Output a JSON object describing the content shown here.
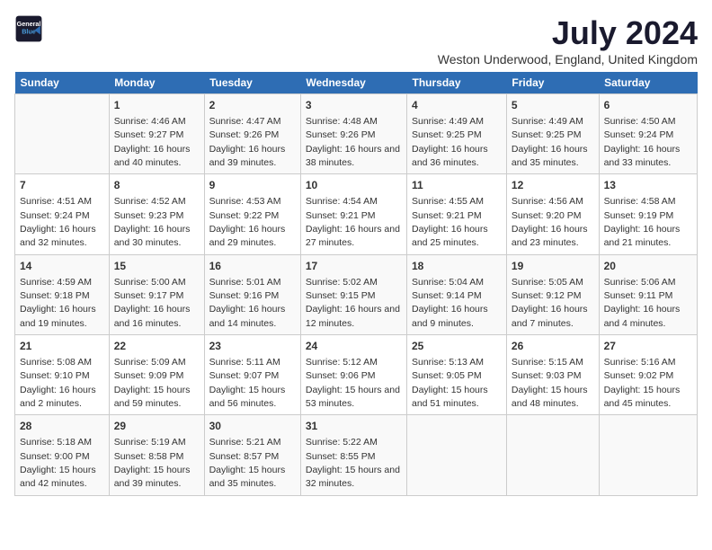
{
  "logo": {
    "line1": "General",
    "line2": "Blue"
  },
  "title": "July 2024",
  "subtitle": "Weston Underwood, England, United Kingdom",
  "headers": [
    "Sunday",
    "Monday",
    "Tuesday",
    "Wednesday",
    "Thursday",
    "Friday",
    "Saturday"
  ],
  "weeks": [
    [
      {
        "day": "",
        "sunrise": "",
        "sunset": "",
        "daylight": ""
      },
      {
        "day": "1",
        "sunrise": "Sunrise: 4:46 AM",
        "sunset": "Sunset: 9:27 PM",
        "daylight": "Daylight: 16 hours and 40 minutes."
      },
      {
        "day": "2",
        "sunrise": "Sunrise: 4:47 AM",
        "sunset": "Sunset: 9:26 PM",
        "daylight": "Daylight: 16 hours and 39 minutes."
      },
      {
        "day": "3",
        "sunrise": "Sunrise: 4:48 AM",
        "sunset": "Sunset: 9:26 PM",
        "daylight": "Daylight: 16 hours and 38 minutes."
      },
      {
        "day": "4",
        "sunrise": "Sunrise: 4:49 AM",
        "sunset": "Sunset: 9:25 PM",
        "daylight": "Daylight: 16 hours and 36 minutes."
      },
      {
        "day": "5",
        "sunrise": "Sunrise: 4:49 AM",
        "sunset": "Sunset: 9:25 PM",
        "daylight": "Daylight: 16 hours and 35 minutes."
      },
      {
        "day": "6",
        "sunrise": "Sunrise: 4:50 AM",
        "sunset": "Sunset: 9:24 PM",
        "daylight": "Daylight: 16 hours and 33 minutes."
      }
    ],
    [
      {
        "day": "7",
        "sunrise": "Sunrise: 4:51 AM",
        "sunset": "Sunset: 9:24 PM",
        "daylight": "Daylight: 16 hours and 32 minutes."
      },
      {
        "day": "8",
        "sunrise": "Sunrise: 4:52 AM",
        "sunset": "Sunset: 9:23 PM",
        "daylight": "Daylight: 16 hours and 30 minutes."
      },
      {
        "day": "9",
        "sunrise": "Sunrise: 4:53 AM",
        "sunset": "Sunset: 9:22 PM",
        "daylight": "Daylight: 16 hours and 29 minutes."
      },
      {
        "day": "10",
        "sunrise": "Sunrise: 4:54 AM",
        "sunset": "Sunset: 9:21 PM",
        "daylight": "Daylight: 16 hours and 27 minutes."
      },
      {
        "day": "11",
        "sunrise": "Sunrise: 4:55 AM",
        "sunset": "Sunset: 9:21 PM",
        "daylight": "Daylight: 16 hours and 25 minutes."
      },
      {
        "day": "12",
        "sunrise": "Sunrise: 4:56 AM",
        "sunset": "Sunset: 9:20 PM",
        "daylight": "Daylight: 16 hours and 23 minutes."
      },
      {
        "day": "13",
        "sunrise": "Sunrise: 4:58 AM",
        "sunset": "Sunset: 9:19 PM",
        "daylight": "Daylight: 16 hours and 21 minutes."
      }
    ],
    [
      {
        "day": "14",
        "sunrise": "Sunrise: 4:59 AM",
        "sunset": "Sunset: 9:18 PM",
        "daylight": "Daylight: 16 hours and 19 minutes."
      },
      {
        "day": "15",
        "sunrise": "Sunrise: 5:00 AM",
        "sunset": "Sunset: 9:17 PM",
        "daylight": "Daylight: 16 hours and 16 minutes."
      },
      {
        "day": "16",
        "sunrise": "Sunrise: 5:01 AM",
        "sunset": "Sunset: 9:16 PM",
        "daylight": "Daylight: 16 hours and 14 minutes."
      },
      {
        "day": "17",
        "sunrise": "Sunrise: 5:02 AM",
        "sunset": "Sunset: 9:15 PM",
        "daylight": "Daylight: 16 hours and 12 minutes."
      },
      {
        "day": "18",
        "sunrise": "Sunrise: 5:04 AM",
        "sunset": "Sunset: 9:14 PM",
        "daylight": "Daylight: 16 hours and 9 minutes."
      },
      {
        "day": "19",
        "sunrise": "Sunrise: 5:05 AM",
        "sunset": "Sunset: 9:12 PM",
        "daylight": "Daylight: 16 hours and 7 minutes."
      },
      {
        "day": "20",
        "sunrise": "Sunrise: 5:06 AM",
        "sunset": "Sunset: 9:11 PM",
        "daylight": "Daylight: 16 hours and 4 minutes."
      }
    ],
    [
      {
        "day": "21",
        "sunrise": "Sunrise: 5:08 AM",
        "sunset": "Sunset: 9:10 PM",
        "daylight": "Daylight: 16 hours and 2 minutes."
      },
      {
        "day": "22",
        "sunrise": "Sunrise: 5:09 AM",
        "sunset": "Sunset: 9:09 PM",
        "daylight": "Daylight: 15 hours and 59 minutes."
      },
      {
        "day": "23",
        "sunrise": "Sunrise: 5:11 AM",
        "sunset": "Sunset: 9:07 PM",
        "daylight": "Daylight: 15 hours and 56 minutes."
      },
      {
        "day": "24",
        "sunrise": "Sunrise: 5:12 AM",
        "sunset": "Sunset: 9:06 PM",
        "daylight": "Daylight: 15 hours and 53 minutes."
      },
      {
        "day": "25",
        "sunrise": "Sunrise: 5:13 AM",
        "sunset": "Sunset: 9:05 PM",
        "daylight": "Daylight: 15 hours and 51 minutes."
      },
      {
        "day": "26",
        "sunrise": "Sunrise: 5:15 AM",
        "sunset": "Sunset: 9:03 PM",
        "daylight": "Daylight: 15 hours and 48 minutes."
      },
      {
        "day": "27",
        "sunrise": "Sunrise: 5:16 AM",
        "sunset": "Sunset: 9:02 PM",
        "daylight": "Daylight: 15 hours and 45 minutes."
      }
    ],
    [
      {
        "day": "28",
        "sunrise": "Sunrise: 5:18 AM",
        "sunset": "Sunset: 9:00 PM",
        "daylight": "Daylight: 15 hours and 42 minutes."
      },
      {
        "day": "29",
        "sunrise": "Sunrise: 5:19 AM",
        "sunset": "Sunset: 8:58 PM",
        "daylight": "Daylight: 15 hours and 39 minutes."
      },
      {
        "day": "30",
        "sunrise": "Sunrise: 5:21 AM",
        "sunset": "Sunset: 8:57 PM",
        "daylight": "Daylight: 15 hours and 35 minutes."
      },
      {
        "day": "31",
        "sunrise": "Sunrise: 5:22 AM",
        "sunset": "Sunset: 8:55 PM",
        "daylight": "Daylight: 15 hours and 32 minutes."
      },
      {
        "day": "",
        "sunrise": "",
        "sunset": "",
        "daylight": ""
      },
      {
        "day": "",
        "sunrise": "",
        "sunset": "",
        "daylight": ""
      },
      {
        "day": "",
        "sunrise": "",
        "sunset": "",
        "daylight": ""
      }
    ]
  ]
}
